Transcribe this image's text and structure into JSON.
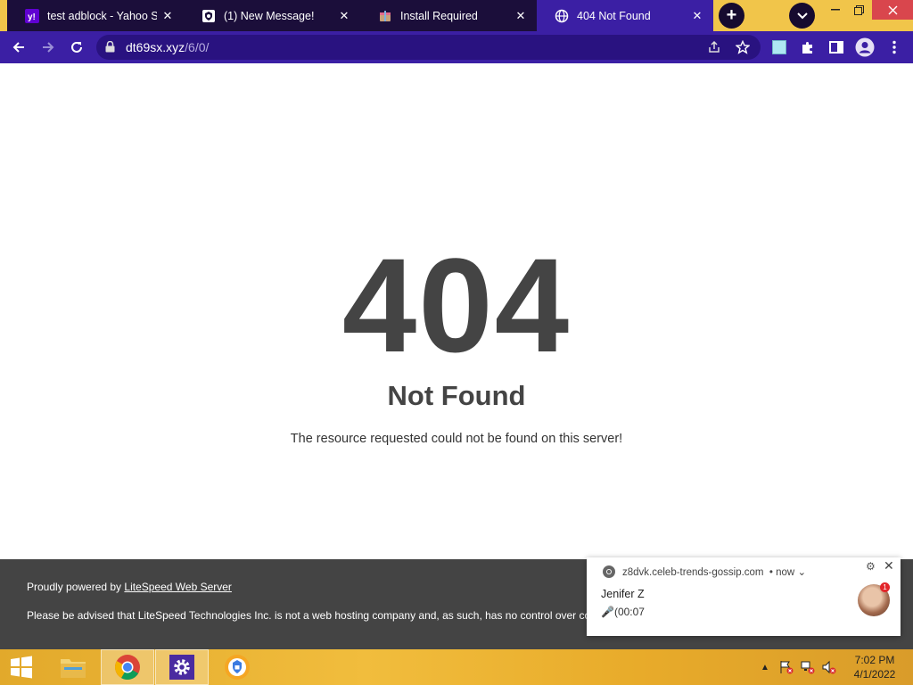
{
  "tabs": [
    {
      "title": "test adblock - Yahoo Sear",
      "favicon": "yahoo-icon",
      "active": false
    },
    {
      "title": "(1) New Message!",
      "favicon": "shield-icon",
      "active": false
    },
    {
      "title": "Install Required",
      "favicon": "package-icon",
      "active": false
    },
    {
      "title": "404 Not Found",
      "favicon": "globe-icon",
      "active": true
    }
  ],
  "address_bar": {
    "host": "dt69sx.xyz",
    "path": "/6/0/"
  },
  "page": {
    "code": "404",
    "heading": "Not Found",
    "description": "The resource requested could not be found on this server!"
  },
  "footer": {
    "powered_prefix": "Proudly powered by ",
    "powered_link": "LiteSpeed Web Server",
    "notice": "Please be advised that LiteSpeed Technologies Inc. is not a web hosting company and, as such, has no control over co"
  },
  "notification": {
    "site": "z8dvk.celeb-trends-gossip.com",
    "time": "now",
    "sender": "Jenifer Z",
    "message": "🎤(00:07",
    "badge_count": "1"
  },
  "taskbar": {
    "clock_time": "7:02 PM",
    "clock_date": "4/1/2022"
  },
  "colors": {
    "tab_active": "#3b1fa4",
    "tab_inactive": "#1b0e3a",
    "titlebar": "#f1c54a",
    "footer_bg": "#444444",
    "heading_text": "#444444"
  }
}
